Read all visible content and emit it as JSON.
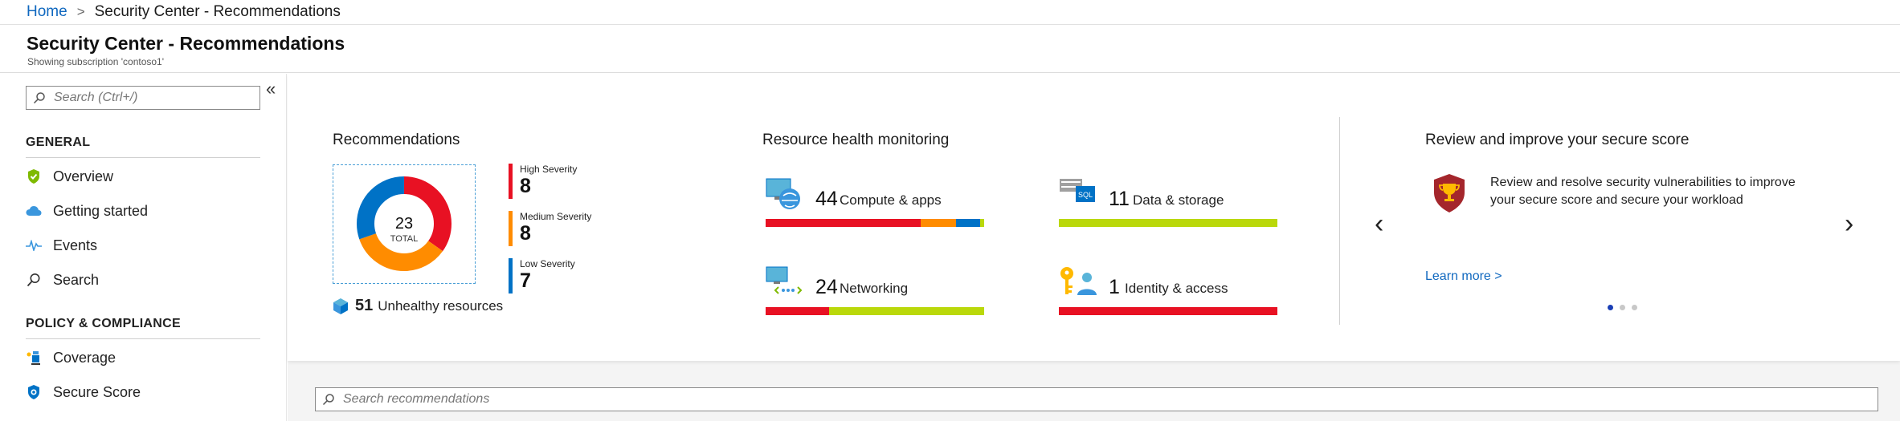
{
  "breadcrumb": {
    "home": "Home",
    "separator": ">",
    "current": "Security Center - Recommendations"
  },
  "header": {
    "title": "Security Center - Recommendations",
    "subtitle": "Showing subscription 'contoso1'"
  },
  "sidebar": {
    "search_placeholder": "Search (Ctrl+/)",
    "collapse_glyph": "«",
    "sections": [
      {
        "title": "GENERAL",
        "items": [
          {
            "label": "Overview",
            "icon": "shield-check-icon"
          },
          {
            "label": "Getting started",
            "icon": "cloud-icon"
          },
          {
            "label": "Events",
            "icon": "pulse-icon"
          },
          {
            "label": "Search",
            "icon": "search-icon"
          }
        ]
      },
      {
        "title": "POLICY & COMPLIANCE",
        "items": [
          {
            "label": "Coverage",
            "icon": "coverage-icon"
          },
          {
            "label": "Secure Score",
            "icon": "secure-score-icon"
          }
        ]
      }
    ]
  },
  "recommendations": {
    "title": "Recommendations",
    "total": "23",
    "total_label": "TOTAL",
    "severities": [
      {
        "label": "High Severity",
        "count": 8,
        "color": "#e81123"
      },
      {
        "label": "Medium Severity",
        "count": 8,
        "color": "#ff8c00"
      },
      {
        "label": "Low Severity",
        "count": 7,
        "color": "#0072c6"
      }
    ],
    "unhealthy_count": "51",
    "unhealthy_label": "Unhealthy resources"
  },
  "resource_health": {
    "title": "Resource health monitoring",
    "items": [
      {
        "count": "44",
        "label": "Compute & apps",
        "icon": "compute-icon",
        "segments": [
          {
            "fraction": 0.71,
            "color": "#e81123"
          },
          {
            "fraction": 0.16,
            "color": "#ff8c00"
          },
          {
            "fraction": 0.11,
            "color": "#0072c6"
          },
          {
            "fraction": 0.02,
            "color": "#bad80a"
          }
        ]
      },
      {
        "count": "11",
        "label": "Data & storage",
        "icon": "sql-storage-icon",
        "segments": [
          {
            "fraction": 1.0,
            "color": "#bad80a"
          }
        ]
      },
      {
        "count": "24",
        "label": "Networking",
        "icon": "networking-icon",
        "segments": [
          {
            "fraction": 0.29,
            "color": "#e81123"
          },
          {
            "fraction": 0.71,
            "color": "#bad80a"
          }
        ]
      },
      {
        "count": "1",
        "label": "Identity & access",
        "icon": "identity-key-icon",
        "segments": [
          {
            "fraction": 1.0,
            "color": "#e81123"
          }
        ]
      }
    ]
  },
  "secure_score": {
    "title": "Review and improve your secure score",
    "description": "Review and resolve security vulnerabilities to improve your secure score and secure your workload",
    "link": "Learn more >",
    "prev": "‹",
    "next": "›",
    "page_dots": 3,
    "active_dot": 0
  },
  "search_recommendations_placeholder": "Search recommendations"
}
